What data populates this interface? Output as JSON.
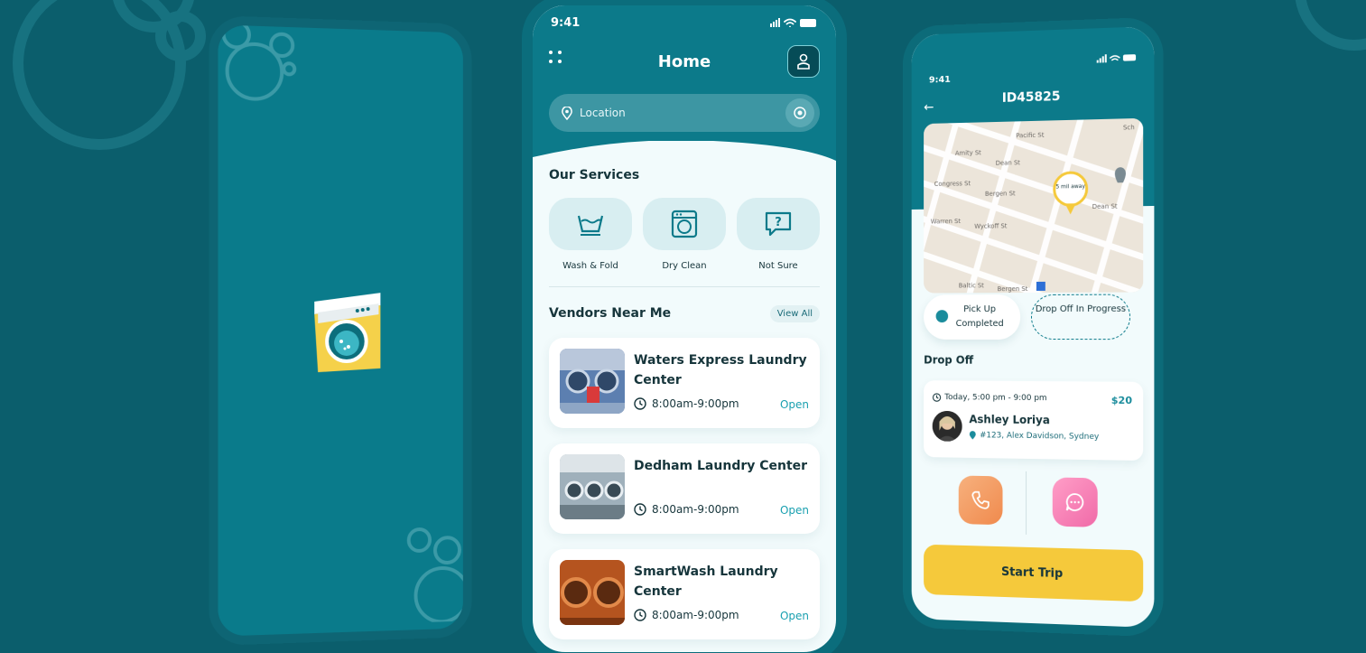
{
  "colors": {
    "background": "#0b5e6c",
    "primary": "#0c7a8a",
    "accent_open": "#1aa0b0",
    "start_button": "#f5c93b"
  },
  "home": {
    "status_time": "9:41",
    "title": "Home",
    "location_placeholder": "Location",
    "services_title": "Our Services",
    "services": [
      {
        "label": "Wash & Fold",
        "icon": "wash-basin-icon"
      },
      {
        "label": "Dry Clean",
        "icon": "washing-machine-icon"
      },
      {
        "label": "Not Sure",
        "icon": "question-bubble-icon"
      }
    ],
    "vendors_title": "Vendors Near Me",
    "view_all": "View All",
    "vendors": [
      {
        "name": "Waters Express Laundry Center",
        "hours": "8:00am-9:00pm",
        "status": "Open"
      },
      {
        "name": "Dedham Laundry Center",
        "hours": "8:00am-9:00pm",
        "status": "Open"
      },
      {
        "name": "SmartWash Laundry Center",
        "hours": "8:00am-9:00pm",
        "status": "Open"
      }
    ]
  },
  "trip": {
    "status_time": "9:41",
    "order_id": "ID45825",
    "map_pin_text": "5 mil away",
    "map_streets": [
      "Pacific St",
      "Dean St",
      "Amity St",
      "Congress St",
      "Bergen St",
      "Warren St",
      "Wyckoff St",
      "Dean St",
      "Baltic St",
      "Bergen St",
      "Sch"
    ],
    "pickup_status": "Pick Up Completed",
    "dropoff_status": "Drop Off In Progress",
    "dropoff_title": "Drop Off",
    "dropoff_time": "Today, 5:00 pm - 9:00 pm",
    "price": "$20",
    "customer_name": "Ashley Loriya",
    "address": "#123, Alex Davidson, Sydney",
    "start_button": "Start Trip"
  }
}
